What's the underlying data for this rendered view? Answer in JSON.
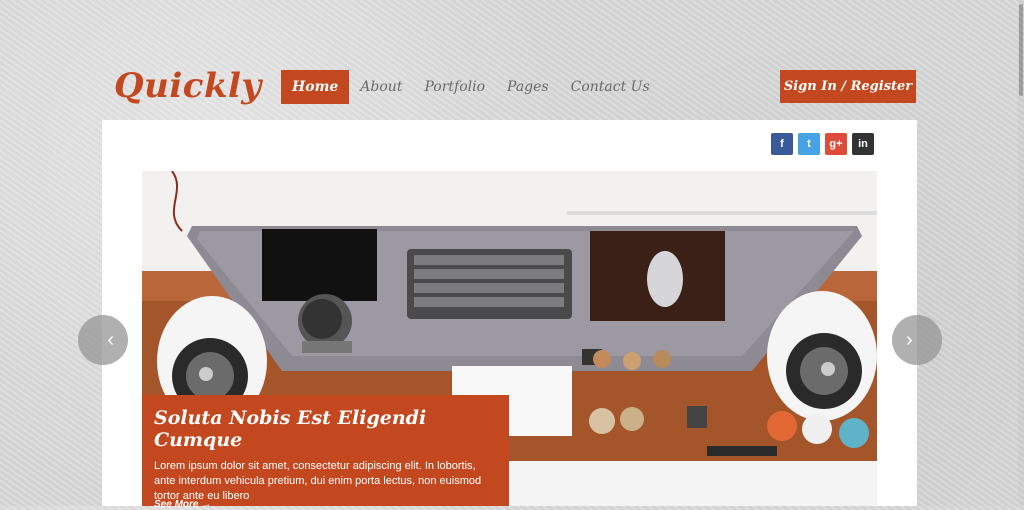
{
  "brand": {
    "logo_text": "Quickly",
    "accent_color": "#c4481f"
  },
  "nav": {
    "items": [
      {
        "label": "Home",
        "active": true
      },
      {
        "label": "About",
        "active": false
      },
      {
        "label": "Portfolio",
        "active": false
      },
      {
        "label": "Pages",
        "active": false
      },
      {
        "label": "Contact Us",
        "active": false
      }
    ]
  },
  "header": {
    "signin_label": "Sign In / Register"
  },
  "social": [
    {
      "icon": "facebook-icon",
      "glyph": "f",
      "color": "#3b5998"
    },
    {
      "icon": "twitter-icon",
      "glyph": "t",
      "color": "#45a3e5"
    },
    {
      "icon": "google-plus-icon",
      "glyph": "g+",
      "color": "#dd4b39"
    },
    {
      "icon": "linkedin-icon",
      "glyph": "in",
      "color": "#333333"
    }
  ],
  "slider": {
    "prev_icon": "chevron-left-icon",
    "next_icon": "chevron-right-icon",
    "prev_glyph": "‹",
    "next_glyph": "›",
    "caption": {
      "title": "Soluta Nobis Est Eligendi Cumque",
      "text": "Lorem ipsum dolor sit amet, consectetur adipiscing elit. In lobortis, ante interdum vehicula pretium, dui enim porta lectus, non euismod tortor ante eu libero",
      "more_label": "See More →"
    }
  }
}
